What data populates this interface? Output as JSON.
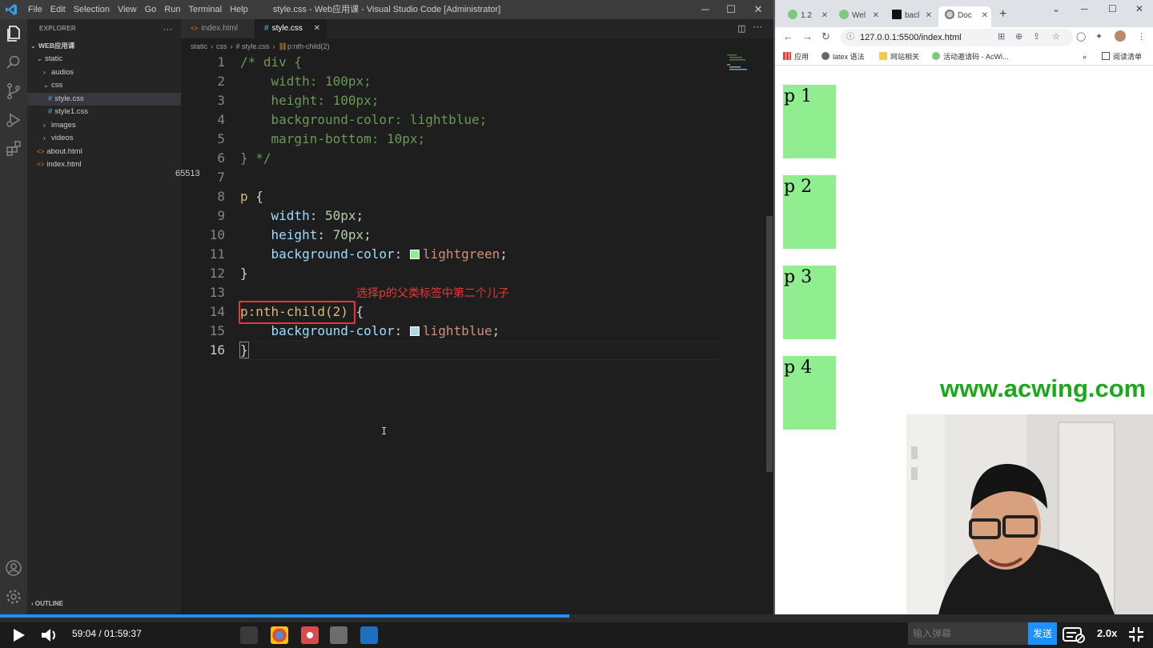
{
  "vscode": {
    "title": "style.css - Web应用课 - Visual Studio Code [Administrator]",
    "menu": [
      "File",
      "Edit",
      "Selection",
      "View",
      "Go",
      "Run",
      "Terminal",
      "Help"
    ],
    "explorer": {
      "header": "EXPLORER",
      "root": "WEB应用课",
      "items": [
        {
          "label": "static",
          "kind": "folder-open"
        },
        {
          "label": "audios",
          "kind": "folder"
        },
        {
          "label": "css",
          "kind": "folder-open"
        },
        {
          "label": "style.css",
          "kind": "css",
          "selected": true
        },
        {
          "label": "style1.css",
          "kind": "css"
        },
        {
          "label": "images",
          "kind": "folder"
        },
        {
          "label": "videos",
          "kind": "folder"
        },
        {
          "label": "about.html",
          "kind": "html"
        },
        {
          "label": "index.html",
          "kind": "html"
        }
      ],
      "outline": "OUTLINE"
    },
    "tabs": [
      {
        "label": "index.html",
        "active": false
      },
      {
        "label": "style.css",
        "active": true
      }
    ],
    "breadcrumb": [
      "static",
      "css",
      "style.css",
      "p:nth-child(2)"
    ],
    "line_numbers": [
      "1",
      "2",
      "3",
      "4",
      "5",
      "6",
      "7",
      "8",
      "9",
      "10",
      "11",
      "12",
      "13",
      "14",
      "15",
      "16"
    ],
    "code": {
      "l1": "/* div {",
      "l2": "    width: 100px;",
      "l3": "    height: 100px;",
      "l4": "    background-color: lightblue;",
      "l5": "    margin-bottom: 10px;",
      "l6": "} */",
      "l8_sel": "p",
      "l8_brace": " {",
      "l9_prop": "width",
      "l9_val": "50px",
      "l10_prop": "height",
      "l10_val": "70px",
      "l11_prop": "background-color",
      "l11_val": "lightgreen",
      "l12": "}",
      "l14_sel": "p:nth-child(2)",
      "l14_brace": " {",
      "l15_prop": "background-color",
      "l15_val": "lightblue",
      "l16": "}"
    },
    "annotation": "选择p的父类标签中第二个儿子",
    "stray_text": "65513"
  },
  "browser": {
    "tabs": [
      {
        "label": "1.2"
      },
      {
        "label": "Wel"
      },
      {
        "label": "bacl"
      },
      {
        "label": "Doc",
        "active": true
      }
    ],
    "url": "127.0.0.1:5500/index.html",
    "bookmarks": [
      "应用",
      "latex 语法",
      "网站相关",
      "活动邀请码 - AcWi...",
      "阅读清单"
    ],
    "paragraphs": [
      "p 1",
      "p 2",
      "p 3",
      "p 4"
    ],
    "watermark": "www.acwing.com"
  },
  "player": {
    "time": "59:04 / 01:59:37",
    "progress": 0.4937,
    "danmaku_placeholder": "输入弹幕",
    "send_label": "发送",
    "speed": "2.0x"
  },
  "colors": {
    "accent": "#1e90ff",
    "lightgreen": "#90ee90",
    "lightblue": "#add8e6",
    "annotation": "#e53935",
    "watermark": "#1ba81b"
  }
}
